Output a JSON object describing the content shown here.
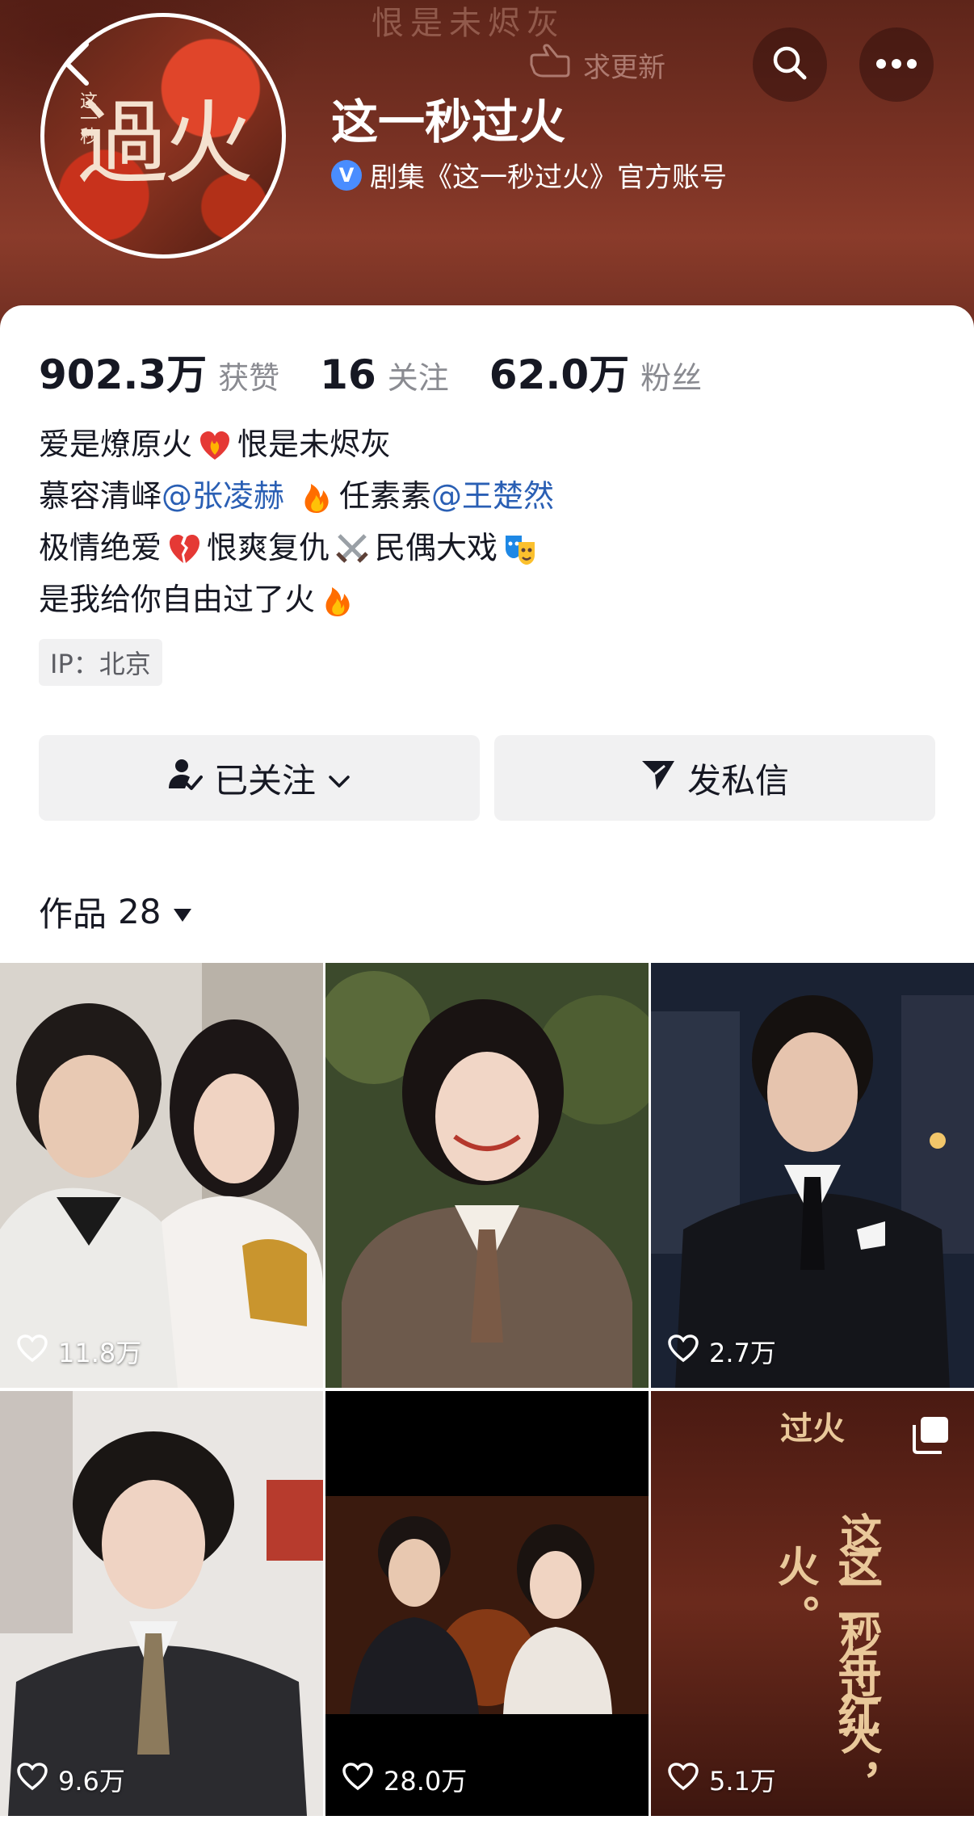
{
  "header": {
    "watermark": "恨是未烬灰",
    "update_label": "求更新",
    "avatar_text": "過火",
    "avatar_sub": "这一秒"
  },
  "profile": {
    "name": "这一秒过火",
    "verify_badge": "V",
    "verified_text": "剧集《这一秒过火》官方账号"
  },
  "stats": [
    {
      "value": "902.3万",
      "label": "获赞"
    },
    {
      "value": "16",
      "label": "关注"
    },
    {
      "value": "62.0万",
      "label": "粉丝"
    }
  ],
  "bio": {
    "line1_a": "爱是燎原火",
    "line1_b": "恨是未烬灰",
    "line2_a": "慕容清峄",
    "line2_mention1": "@张凌赫",
    "line2_b": "任素素",
    "line2_mention2": "@王楚然",
    "line3_a": "极情绝爱",
    "line3_b": "恨爽复仇",
    "line3_c": "民偶大戏",
    "line4_a": "是我给你自由过了火"
  },
  "ip_location": "IP：北京",
  "actions": {
    "follow_label": "已关注",
    "message_label": "发私信"
  },
  "works": {
    "label": "作品",
    "count": "28"
  },
  "videos": [
    {
      "likes": "11.8万"
    },
    {
      "likes": ""
    },
    {
      "likes": "2.7万"
    },
    {
      "likes": "9.6万"
    },
    {
      "likes": "28.0万"
    },
    {
      "likes": "5.1万",
      "poster_title": "过火",
      "poster_line1": "这一秒过火，",
      "poster_line2": "这一年红火。"
    }
  ],
  "colors": {
    "header": "#7a3224",
    "mention": "#2a5fb4",
    "verify": "#4a8dff"
  }
}
